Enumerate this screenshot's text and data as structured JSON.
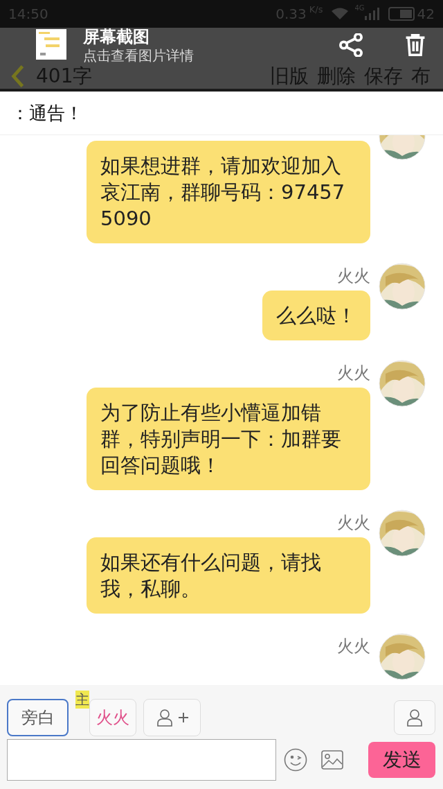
{
  "status_bar": {
    "time": "14:50",
    "speed": "0.33",
    "speed_unit": "K/s",
    "network": "4G",
    "battery": "42"
  },
  "toolbar": {
    "count": "401字",
    "actions": [
      "旧版",
      "删除",
      "保存",
      "布"
    ]
  },
  "notification": {
    "title": "屏幕截图",
    "subtitle": "点击查看图片详情"
  },
  "notice": "：通告！",
  "messages": [
    {
      "kind": "message",
      "text": "如果想进群，请加欢迎加入哀江南，群聊号码：974575090"
    },
    {
      "kind": "message",
      "name": "火火",
      "text": "么么哒！"
    },
    {
      "kind": "message",
      "name": "火火",
      "text": "为了防止有些小懵逼加错群，特别声明一下：加群要回答问题哦！"
    },
    {
      "kind": "message",
      "name": "火火",
      "text": "如果还有什么问题，请找我，私聊。"
    },
    {
      "kind": "name_only",
      "name": "火火"
    }
  ],
  "roles": [
    {
      "label": "旁白",
      "selected": true
    },
    {
      "label": "火火",
      "badge": "主",
      "selected": false
    }
  ],
  "composer": {
    "send": "发送"
  }
}
